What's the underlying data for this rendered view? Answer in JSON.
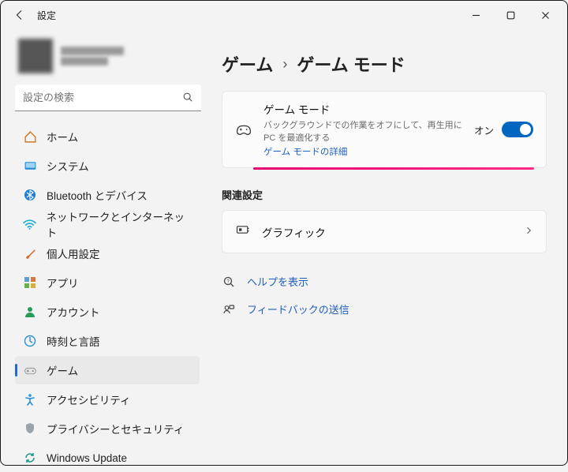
{
  "window": {
    "title": "設定"
  },
  "search": {
    "placeholder": "設定の検索"
  },
  "sidebar": {
    "items": [
      {
        "label": "ホーム"
      },
      {
        "label": "システム"
      },
      {
        "label": "Bluetooth とデバイス"
      },
      {
        "label": "ネットワークとインターネット"
      },
      {
        "label": "個人用設定"
      },
      {
        "label": "アプリ"
      },
      {
        "label": "アカウント"
      },
      {
        "label": "時刻と言語"
      },
      {
        "label": "ゲーム"
      },
      {
        "label": "アクセシビリティ"
      },
      {
        "label": "プライバシーとセキュリティ"
      },
      {
        "label": "Windows Update"
      }
    ]
  },
  "breadcrumb": {
    "parent": "ゲーム",
    "current": "ゲーム モード"
  },
  "game_mode_card": {
    "title": "ゲーム モード",
    "desc": "バックグラウンドでの作業をオフにして、再生用に PC を最適化する",
    "link": "ゲーム モードの詳細",
    "toggle_label": "オン",
    "on": true
  },
  "related": {
    "label": "関連設定",
    "graphics": "グラフィック"
  },
  "footer_links": {
    "help": "ヘルプを表示",
    "feedback": "フィードバックの送信"
  }
}
